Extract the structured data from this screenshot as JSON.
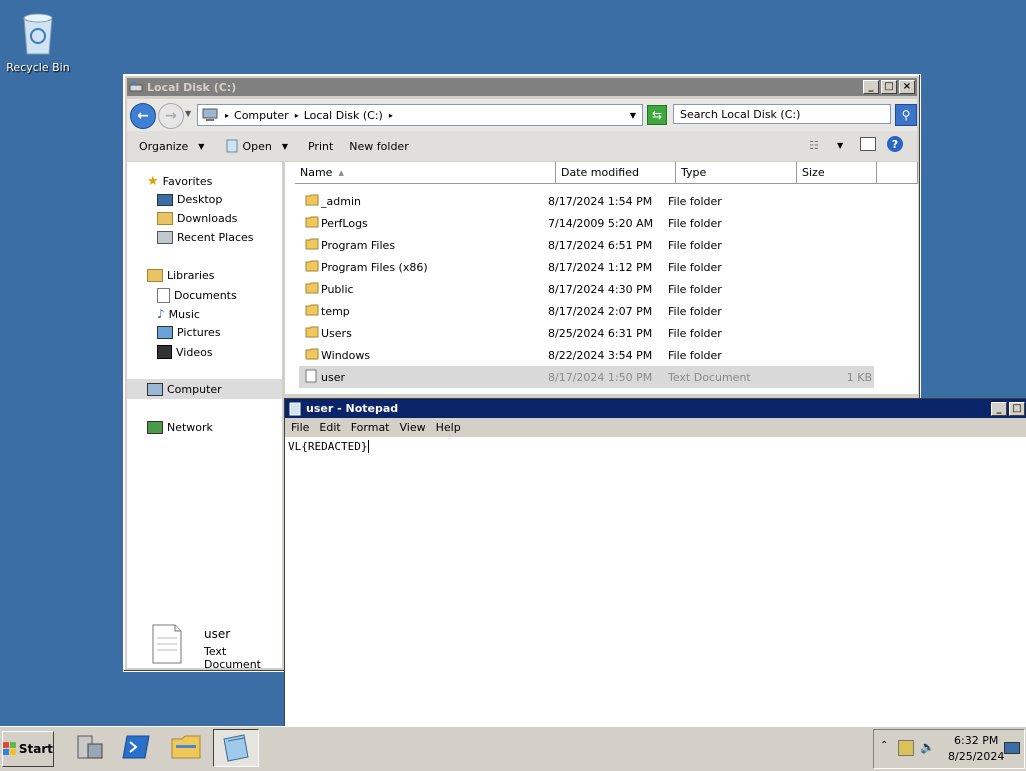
{
  "desktop": {
    "recycle_bin_label": "Recycle Bin"
  },
  "explorer": {
    "title": "Local Disk (C:)",
    "breadcrumb": [
      "Computer",
      "Local Disk (C:)"
    ],
    "search_placeholder": "Search Local Disk (C:)",
    "commands": {
      "organize": "Organize",
      "open": "Open",
      "print": "Print",
      "new_folder": "New folder"
    },
    "nav": {
      "favorites": "Favorites",
      "desktop": "Desktop",
      "downloads": "Downloads",
      "recent_places": "Recent Places",
      "libraries": "Libraries",
      "documents": "Documents",
      "music": "Music",
      "pictures": "Pictures",
      "videos": "Videos",
      "computer": "Computer",
      "network": "Network"
    },
    "columns": {
      "name": "Name",
      "date": "Date modified",
      "type": "Type",
      "size": "Size"
    },
    "files": [
      {
        "name": "_admin",
        "date": "8/17/2024 1:54 PM",
        "type": "File folder",
        "size": ""
      },
      {
        "name": "PerfLogs",
        "date": "7/14/2009 5:20 AM",
        "type": "File folder",
        "size": ""
      },
      {
        "name": "Program Files",
        "date": "8/17/2024 6:51 PM",
        "type": "File folder",
        "size": ""
      },
      {
        "name": "Program Files (x86)",
        "date": "8/17/2024 1:12 PM",
        "type": "File folder",
        "size": ""
      },
      {
        "name": "Public",
        "date": "8/17/2024 4:30 PM",
        "type": "File folder",
        "size": ""
      },
      {
        "name": "temp",
        "date": "8/17/2024 2:07 PM",
        "type": "File folder",
        "size": ""
      },
      {
        "name": "Users",
        "date": "8/25/2024 6:31 PM",
        "type": "File folder",
        "size": ""
      },
      {
        "name": "Windows",
        "date": "8/22/2024 3:54 PM",
        "type": "File folder",
        "size": ""
      },
      {
        "name": "user",
        "date": "8/17/2024 1:50 PM",
        "type": "Text Document",
        "size": "1 KB"
      }
    ],
    "details": {
      "name": "user",
      "type": "Text Document"
    }
  },
  "notepad": {
    "title": "user - Notepad",
    "menu": [
      "File",
      "Edit",
      "Format",
      "View",
      "Help"
    ],
    "content": "VL{REDACTED}"
  },
  "taskbar": {
    "start_label": "Start",
    "time": "6:32 PM",
    "date": "8/25/2024"
  },
  "colors": {
    "desktop": "#3a6ea5",
    "notepad_title": "#0a246a",
    "explorer_title_inactive": "#808080"
  }
}
